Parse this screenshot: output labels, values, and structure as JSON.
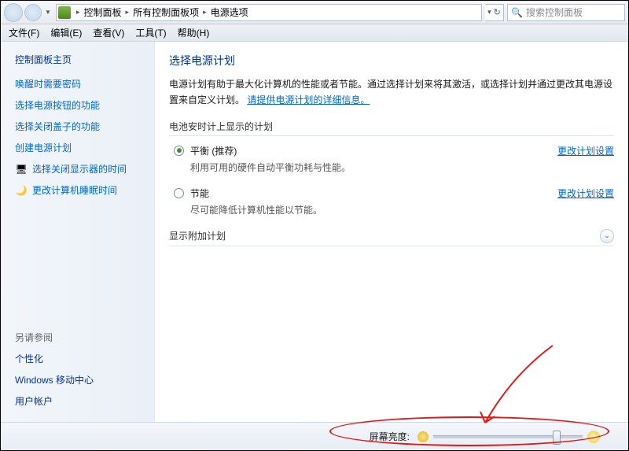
{
  "addressbar": {
    "crumbs": [
      "控制面板",
      "所有控制面板项",
      "电源选项"
    ],
    "search_placeholder": "搜索控制面板"
  },
  "menubar": {
    "items": [
      {
        "label": "文件(F)"
      },
      {
        "label": "编辑(E)"
      },
      {
        "label": "查看(V)"
      },
      {
        "label": "工具(T)"
      },
      {
        "label": "帮助(H)"
      }
    ]
  },
  "sidebar": {
    "home": "控制面板主页",
    "links": [
      {
        "label": "唤醒时需要密码"
      },
      {
        "label": "选择电源按钮的功能"
      },
      {
        "label": "选择关闭盖子的功能"
      },
      {
        "label": "创建电源计划"
      },
      {
        "label": "选择关闭显示器的时间",
        "icon": "monitor"
      },
      {
        "label": "更改计算机睡眠时间",
        "icon": "moon"
      }
    ],
    "seealso_header": "另请参阅",
    "seealso": [
      {
        "label": "个性化"
      },
      {
        "label": "Windows 移动中心"
      },
      {
        "label": "用户帐户"
      }
    ]
  },
  "content": {
    "title": "选择电源计划",
    "desc_prefix": "电源计划有助于最大化计算机的性能或者节能。通过选择计划来将其激活，或选择计划并通过更改其电源设置来自定义计划。",
    "desc_link": "请提供电源计划的详细信息。",
    "group1_header": "电池安时计上显示的计划",
    "plans": [
      {
        "name": "平衡 (推荐)",
        "sub": "利用可用的硬件自动平衡功耗与性能。",
        "selected": true,
        "change": "更改计划设置"
      },
      {
        "name": "节能",
        "sub": "尽可能降低计算机性能以节能。",
        "selected": false,
        "change": "更改计划设置"
      }
    ],
    "group2_header": "显示附加计划"
  },
  "bottom": {
    "label": "屏幕亮度:",
    "slider_percent": 80
  }
}
